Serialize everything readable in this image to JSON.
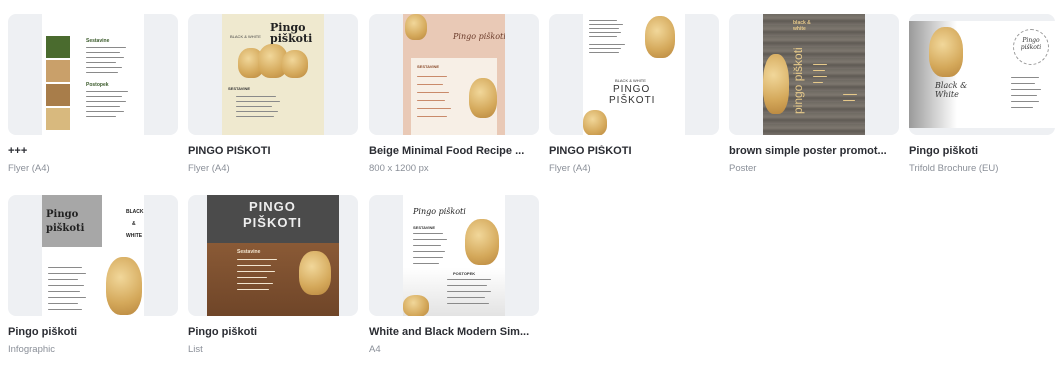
{
  "designs": [
    {
      "title": "+++",
      "subtitle": "Flyer (A4)"
    },
    {
      "title": "PINGO PIŠKOTI",
      "subtitle": "Flyer (A4)"
    },
    {
      "title": "Beige Minimal Food Recipe ...",
      "subtitle": "800 x 1200 px"
    },
    {
      "title": "PINGO PIŠKOTI",
      "subtitle": "Flyer (A4)"
    },
    {
      "title": "brown simple poster promot...",
      "subtitle": "Poster"
    },
    {
      "title": "Pingo piškoti",
      "subtitle": "Trifold Brochure (EU)"
    },
    {
      "title": "Pingo piškoti",
      "subtitle": "Infographic"
    },
    {
      "title": "Pingo piškoti",
      "subtitle": "List"
    },
    {
      "title": "White and Black Modern Sim...",
      "subtitle": "A4"
    }
  ],
  "previews": {
    "p1": {
      "heading1": "Sestavine",
      "heading2": "Postopek"
    },
    "p2": {
      "title": "Pingo piškoti",
      "small": "BLACK & WHITE",
      "section": "SESTAVINE"
    },
    "p3": {
      "title": "Pingo piškoti",
      "section": "SESTAVINE"
    },
    "p4": {
      "small": "BLACK & WHITE",
      "title1": "PINGO",
      "title2": "PIŠKOTI"
    },
    "p5": {
      "small": "black & white",
      "vertical": "pingo piškoti"
    },
    "p6": {
      "script": "Black & White",
      "badge": "Pingo piškoti"
    },
    "p7": {
      "title1": "Pingo",
      "title2": "piškoti",
      "right1": "BLACK",
      "right2": "&",
      "right3": "WHITE"
    },
    "p8": {
      "title1": "PINGO",
      "title2": "PIŠKOTI",
      "section": "Sestavine"
    },
    "p9": {
      "title": "Pingo piškoti",
      "section1": "SESTAVINE",
      "section2": "POSTOPEK"
    }
  },
  "colors": {
    "thumb_bg": "#eef0f3",
    "title": "#2b2d33",
    "subtitle": "#8a8f98"
  }
}
